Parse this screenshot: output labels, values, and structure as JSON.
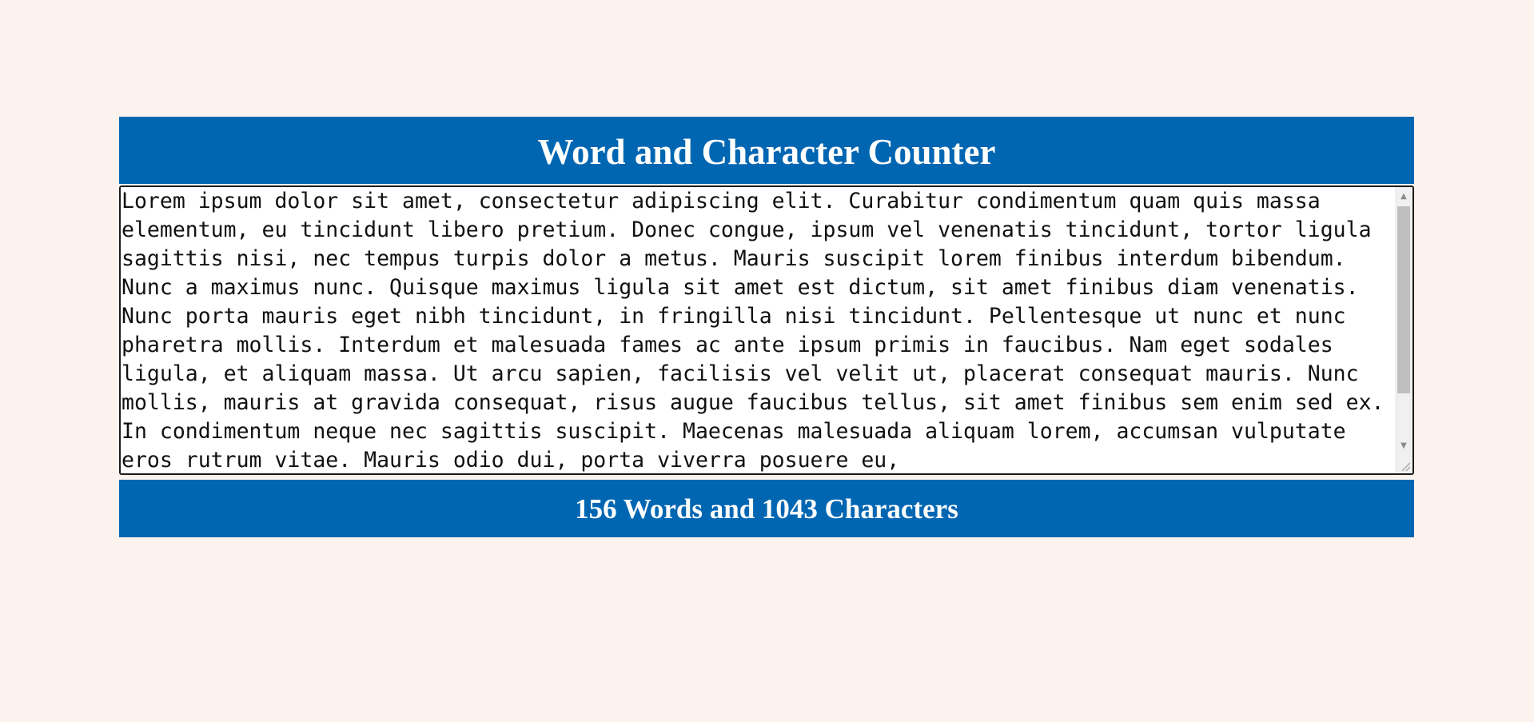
{
  "title": "Word and Character Counter",
  "editor": {
    "text": "Lorem ipsum dolor sit amet, consectetur adipiscing elit. Curabitur condimentum quam quis massa elementum, eu tincidunt libero pretium. Donec congue, ipsum vel venenatis tincidunt, tortor ligula sagittis nisi, nec tempus turpis dolor a metus. Mauris suscipit lorem finibus interdum bibendum. Nunc a maximus nunc. Quisque maximus ligula sit amet est dictum, sit amet finibus diam venenatis. Nunc porta mauris eget nibh tincidunt, in fringilla nisi tincidunt. Pellentesque ut nunc et nunc pharetra mollis. Interdum et malesuada fames ac ante ipsum primis in faucibus. Nam eget sodales ligula, et aliquam massa. Ut arcu sapien, facilisis vel velit ut, placerat consequat mauris. Nunc mollis, mauris at gravida consequat, risus augue faucibus tellus, sit amet finibus sem enim sed ex. In condimentum neque nec sagittis suscipit. Maecenas malesuada aliquam lorem, accumsan vulputate eros rutrum vitae. Mauris odio dui, porta viverra posuere eu,"
  },
  "counter": {
    "summary": "156 Words and 1043 Characters"
  },
  "colors": {
    "page_background": "#fcf3ee",
    "header_background": "#0066b2",
    "header_text": "#ffffff"
  },
  "icons": {
    "scroll_up": "chevron-up-icon",
    "scroll_down": "chevron-down-icon",
    "resize": "resize-grip-icon"
  }
}
